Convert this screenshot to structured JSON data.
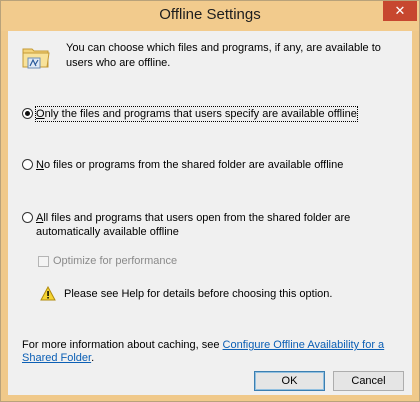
{
  "window": {
    "title": "Offline Settings",
    "close_glyph": "✕"
  },
  "intro": {
    "icon": "offline-folder-icon",
    "text": "You can choose which files and programs, if any, are available to users who are offline."
  },
  "options": [
    {
      "mnemonic": "O",
      "label_rest": "nly the files and programs that users specify are available offline",
      "checked": true
    },
    {
      "mnemonic": "N",
      "label_rest": "o files or programs from the shared folder are available offline",
      "checked": false
    },
    {
      "mnemonic": "A",
      "label_rest": "ll files and programs that users open from the shared folder are automatically available offline",
      "checked": false
    }
  ],
  "optimize": {
    "label": "Optimize for performance",
    "checked": false,
    "enabled": false
  },
  "warning": {
    "icon": "warning-icon",
    "text": "Please see Help for details before choosing this option."
  },
  "more_info": {
    "prefix": "For more information about caching, see ",
    "link_text": "Configure Offline Availability for a Shared Folder",
    "suffix": "."
  },
  "buttons": {
    "ok": "OK",
    "cancel": "Cancel"
  },
  "colors": {
    "titlebar": "#f2cb8d",
    "close": "#c7472f",
    "link": "#0b5fb5"
  }
}
